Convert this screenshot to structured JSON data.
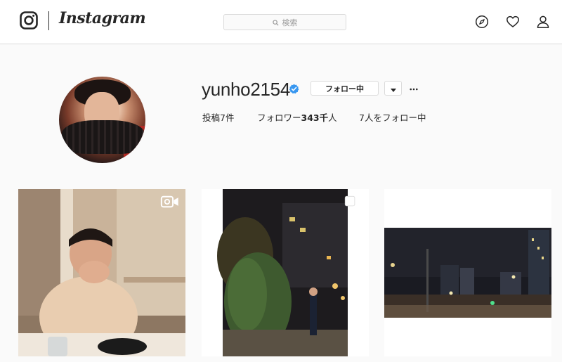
{
  "header": {
    "brand": "Instagram",
    "search_placeholder": "検索",
    "icons": [
      "instagram-glyph-icon",
      "search-icon",
      "compass-icon",
      "heart-icon",
      "user-icon"
    ]
  },
  "profile": {
    "username": "yunho2154",
    "verified": true,
    "follow_button": "フォロー中",
    "stats": {
      "posts": "投稿7件",
      "followers_label": "フォロワー",
      "followers_count": "343千",
      "followers_unit": "人",
      "following": "7人をフォロー中"
    }
  },
  "posts": [
    {
      "type": "video",
      "badge": "video-camera-icon"
    },
    {
      "type": "multiple",
      "badge": "carousel-icon"
    },
    {
      "type": "photo"
    }
  ],
  "colors": {
    "verified": "#3897f0",
    "border": "#dbdbdb",
    "background": "#fafafa"
  }
}
